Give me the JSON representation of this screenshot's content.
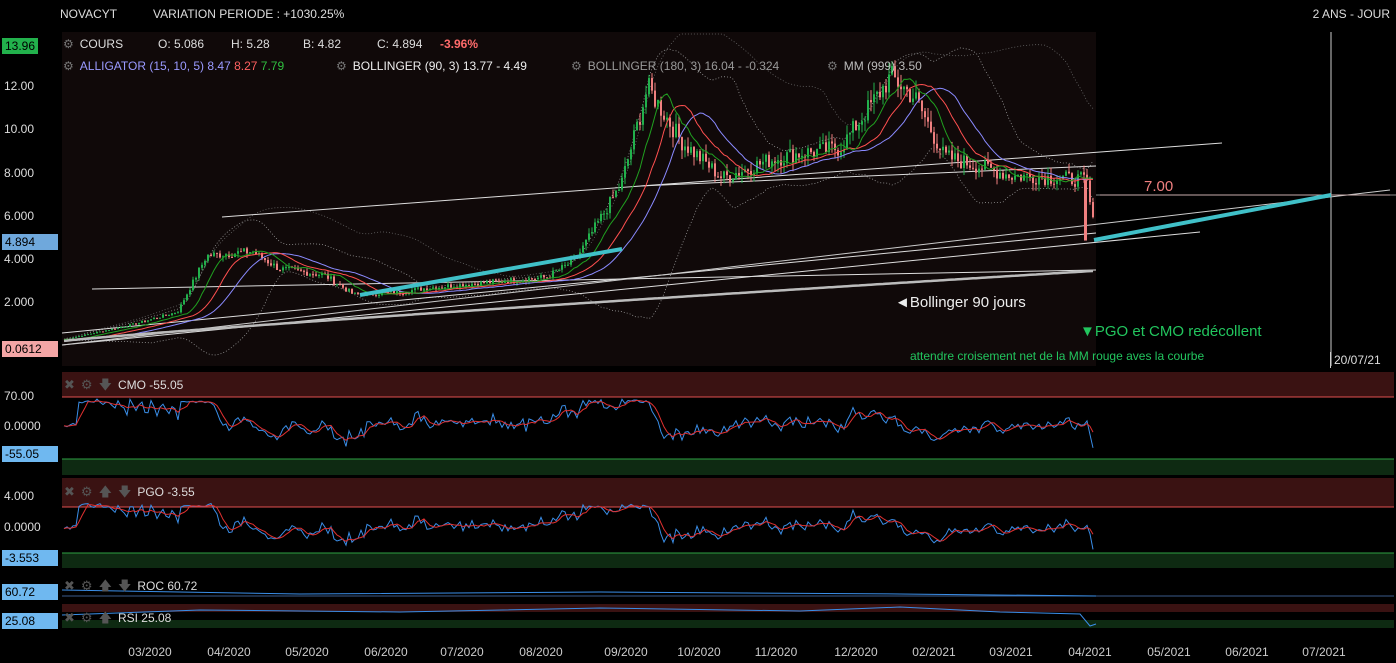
{
  "header": {
    "symbol": "NOVACYT",
    "variation": "VARIATION PERIODE : +1030.25%",
    "timeframe": "2 ANS - JOUR"
  },
  "legend": {
    "cours": {
      "name": "COURS",
      "o": "O: 5.086",
      "h": "H: 5.28",
      "b": "B: 4.82",
      "c": "C: 4.894",
      "chg": "-3.96%"
    },
    "alligator": {
      "name": "ALLIGATOR (15, 10, 5)",
      "v1": "8.47",
      "v2": "8.27",
      "v3": "7.79"
    },
    "boll90": {
      "name": "BOLLINGER (90, 3)",
      "vals": "13.77 - 4.49"
    },
    "boll180": {
      "name": "BOLLINGER (180, 3)",
      "vals": "16.04 - -0.324"
    },
    "mm": {
      "name": "MM (999)",
      "vals": "3.50"
    }
  },
  "price_labels": {
    "high": "13.96",
    "last": "4.894",
    "low": "0.0612",
    "date": "20/07/21"
  },
  "annotations": {
    "target": "7.00",
    "bollinger": "◄Bollinger 90 jours",
    "pgo_cmo": "▼PGO et CMO redécollent",
    "wait": "attendre croisement net de la MM rouge aves la courbe"
  },
  "panels": {
    "cmo": {
      "title": "CMO -55.05",
      "value_label": "-55.05",
      "ticks": [
        "70.00",
        "0.0000"
      ]
    },
    "pgo": {
      "title": "PGO -3.55",
      "value_label": "-3.553",
      "ticks": [
        "4.000",
        "0.0000"
      ]
    },
    "roc": {
      "title": "ROC 60.72",
      "value_label": "60.72"
    },
    "rsi": {
      "title": "RSI 25.08",
      "value_label": "25.08"
    }
  },
  "colors": {
    "up": "#22b14c",
    "down": "#f08080",
    "alligator_jaw": "#8a8aff",
    "alligator_teeth": "#ff5050",
    "alligator_lips": "#20a020",
    "mm": "#bbbbbb",
    "trend": "#40c0c8",
    "panel_band_top": "#3a1212",
    "panel_band_bottom": "#0e2a12",
    "osc_main": "#3a8ee8",
    "osc_signal": "#e03030"
  },
  "chart_data": {
    "type": "line",
    "title": "NOVACYT",
    "xlabel": "",
    "ylabel": "",
    "ylim": [
      0.0612,
      13.96
    ],
    "y_ticks": [
      "2.000",
      "4.000",
      "6.000",
      "8.000",
      "10.00",
      "12.00"
    ],
    "x_ticks": [
      "03/2020",
      "04/2020",
      "05/2020",
      "06/2020",
      "07/2020",
      "08/2020",
      "09/2020",
      "10/2020",
      "11/2020",
      "12/2020",
      "02/2021",
      "03/2021",
      "04/2021",
      "05/2021",
      "06/2021",
      "07/2021"
    ],
    "series": [
      {
        "name": "COURS",
        "x": [
          "2020-02",
          "2020-03",
          "2020-03-20",
          "2020-04-01",
          "2020-04-20",
          "2020-05-01",
          "2020-05-20",
          "2020-06-01",
          "2020-06-20",
          "2020-07-01",
          "2020-07-20",
          "2020-08-01",
          "2020-08-20",
          "2020-09-01",
          "2020-09-20",
          "2020-10-01",
          "2020-10-15",
          "2020-11-01",
          "2020-11-20",
          "2020-12-01",
          "2020-12-20",
          "2021-01-10",
          "2021-01-20",
          "2021-02-01",
          "2021-02-20",
          "2021-03-01",
          "2021-03-20",
          "2021-04-01",
          "2021-04-05"
        ],
        "values": [
          0.3,
          1.0,
          1.6,
          4.2,
          4.4,
          3.6,
          3.3,
          2.4,
          2.5,
          2.7,
          2.9,
          3.0,
          3.2,
          4.0,
          7.5,
          12.0,
          9.5,
          7.8,
          8.6,
          8.9,
          9.2,
          12.5,
          11.5,
          8.8,
          8.2,
          7.9,
          7.8,
          7.7,
          4.9
        ]
      }
    ]
  }
}
